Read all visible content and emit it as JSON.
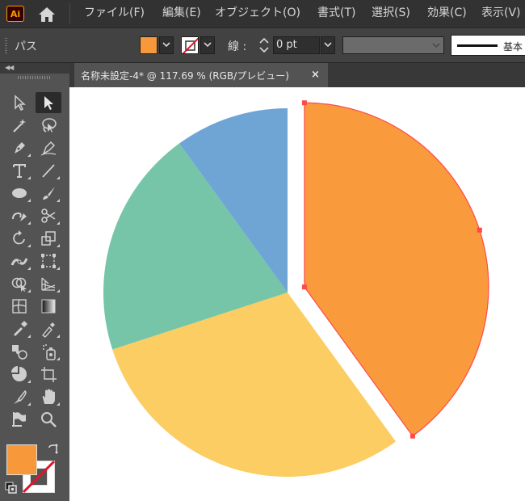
{
  "app": {
    "logo_text": "Ai",
    "menus": [
      "ファイル(F)",
      "編集(E)",
      "オブジェクト(O)",
      "書式(T)",
      "選択(S)",
      "効果(C)",
      "表示(V)"
    ]
  },
  "control_bar": {
    "object_type": "パス",
    "fill_color": "#f7993a",
    "stroke_label": "線 :",
    "stroke_weight": "0 pt",
    "brush_label": "基本"
  },
  "document_tab": {
    "title": "名称未設定-4* @ 117.69 % (RGB/プレビュー)",
    "close_glyph": "×"
  },
  "toolbox": {
    "fill_color": "#f7993a",
    "tools": [
      "selection-tool",
      "direct-selection-tool",
      "magic-wand-tool",
      "lasso-tool",
      "pen-tool",
      "curvature-tool",
      "type-tool",
      "line-segment-tool",
      "ellipse-tool",
      "paintbrush-tool",
      "shaper-tool",
      "scissors-tool",
      "rotate-tool",
      "scale-tool",
      "width-tool",
      "free-transform-tool",
      "shape-builder-tool",
      "perspective-grid-tool",
      "mesh-tool",
      "gradient-tool",
      "eyedropper-tool",
      "measure-tool",
      "blend-tool",
      "symbol-sprayer-tool",
      "column-graph-tool",
      "artboard-tool",
      "slice-tool",
      "hand-tool",
      "flag-tool",
      "zoom-tool"
    ]
  },
  "artwork": {
    "slices": [
      {
        "name": "orange-slice",
        "color": "#f99a3c",
        "share": 0.4,
        "selected": true
      },
      {
        "name": "yellow-slice",
        "color": "#fbcd63",
        "share": 0.3
      },
      {
        "name": "green-slice",
        "color": "#76c5a8",
        "share": 0.2
      },
      {
        "name": "blue-slice",
        "color": "#6fa5d5",
        "share": 0.1
      }
    ],
    "selection_color": "#ff4a4a"
  }
}
